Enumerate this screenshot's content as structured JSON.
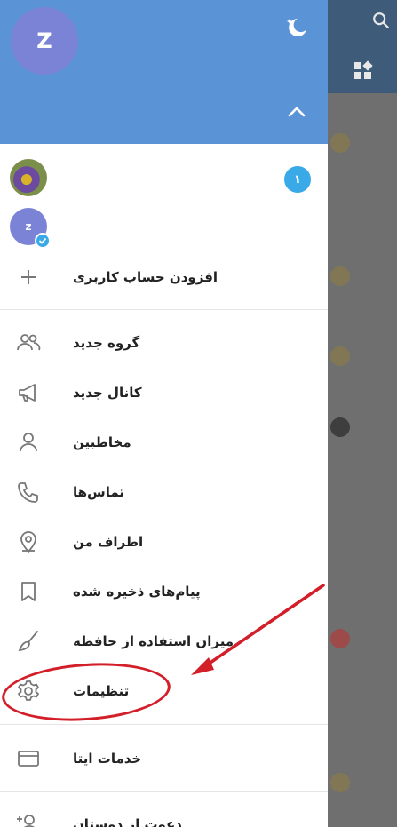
{
  "header": {
    "avatar_letter": "Z",
    "theme_toggle_icon": "moon-icon",
    "collapse_icon": "chevron-up-icon"
  },
  "accounts": {
    "second_avatar_letter": "z",
    "unread_count": "۱",
    "add_account_label": "افزودن حساب کاربری"
  },
  "menu": {
    "new_group": "گروه جدید",
    "new_channel": "کانال جدید",
    "contacts": "مخاطبین",
    "calls": "تماس‌ها",
    "nearby": "اطراف من",
    "saved_messages": "پیام‌های ذخیره شده",
    "storage_usage": "میزان استفاده از حافظه",
    "settings": "تنظیمات",
    "eitaa_services": "خدمات ایتا",
    "invite_friends": "دعوت از دوستان"
  },
  "annotation": {
    "highlight_color": "#d21f2a"
  },
  "colors": {
    "header_bg": "#5b94d6",
    "accent": "#3aa9e8"
  }
}
